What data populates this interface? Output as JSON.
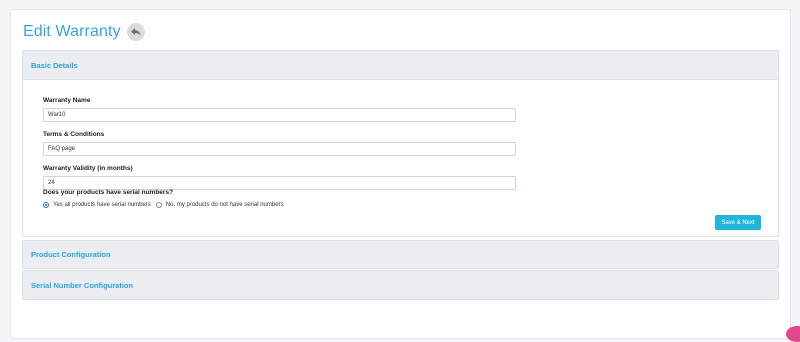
{
  "page": {
    "title": "Edit Warranty"
  },
  "colors": {
    "accent": "#35a7df",
    "button": "#1fb6da",
    "radio_checked": "#2f6fd9"
  },
  "icons": {
    "back": "reply-arrow-icon"
  },
  "basic_details": {
    "header": "Basic Details",
    "warranty_name": {
      "label": "Warranty Name",
      "value": "War10"
    },
    "terms": {
      "label": "Terms & Conditions",
      "value": "FAQ page"
    },
    "validity": {
      "label": "Warranty Validity (in months)",
      "value": "24"
    },
    "serial_question": "Does your products have serial numbers?",
    "serial_options": [
      {
        "label": "Yes all products have serial numbers",
        "checked": true
      },
      {
        "label": "No, my products do not have serial numbers",
        "checked": false
      }
    ],
    "save_label": "Save & Next"
  },
  "product_config": {
    "header": "Product Configuration"
  },
  "serial_config": {
    "header": "Serial Number Configuration"
  }
}
